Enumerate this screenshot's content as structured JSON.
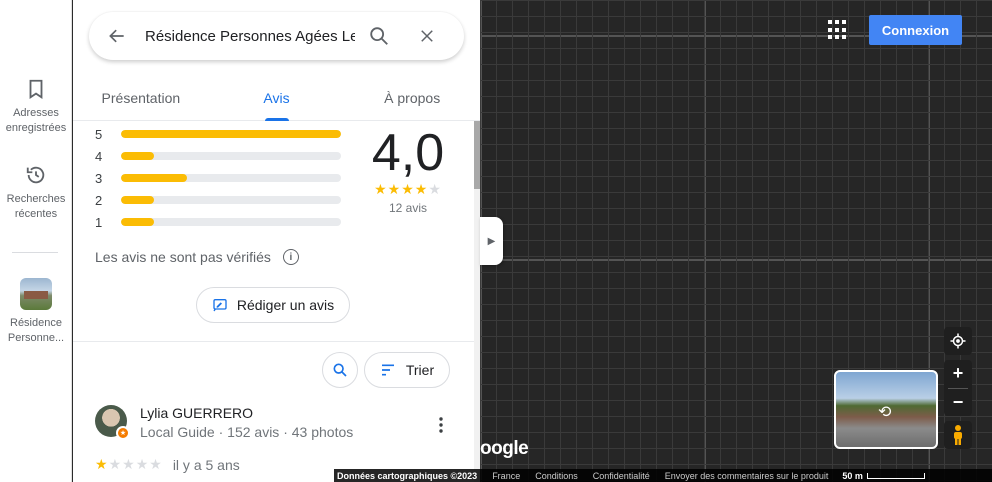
{
  "rail": {
    "saved_label": "Adresses enregistrées",
    "recent_label": "Recherches récentes",
    "place_label": "Résidence Personne..."
  },
  "search": {
    "query": "Résidence Personnes Agées Le"
  },
  "tabs": [
    {
      "label": "Présentation",
      "active": false
    },
    {
      "label": "Avis",
      "active": true
    },
    {
      "label": "À propos",
      "active": false
    }
  ],
  "ratings": {
    "bars": [
      {
        "stars": "5",
        "fraction": 1.0
      },
      {
        "stars": "4",
        "fraction": 0.15
      },
      {
        "stars": "3",
        "fraction": 0.3
      },
      {
        "stars": "2",
        "fraction": 0.15
      },
      {
        "stars": "1",
        "fraction": 0.15
      }
    ],
    "average": "4,0",
    "stars_filled": 4,
    "review_count": "12 avis"
  },
  "notice": "Les avis ne sont pas vérifiés",
  "write_review_label": "Rédiger un avis",
  "sort_label": "Trier",
  "review": {
    "author": "Lylia GUERRERO",
    "meta": "Local Guide · 152 avis · 43 photos",
    "stars_filled": 1,
    "date": "il y a 5 ans"
  },
  "map": {
    "signin_label": "Connexion",
    "google_text": "oogle",
    "footer": {
      "copyright": "Données cartographiques ©2023",
      "country": "France",
      "terms": "Conditions",
      "privacy": "Confidentialité",
      "feedback": "Envoyer des commentaires sur le produit",
      "scale": "50 m"
    }
  },
  "colors": {
    "accent": "#1a73e8",
    "star": "#fbbc04",
    "signin": "#4285f4"
  }
}
